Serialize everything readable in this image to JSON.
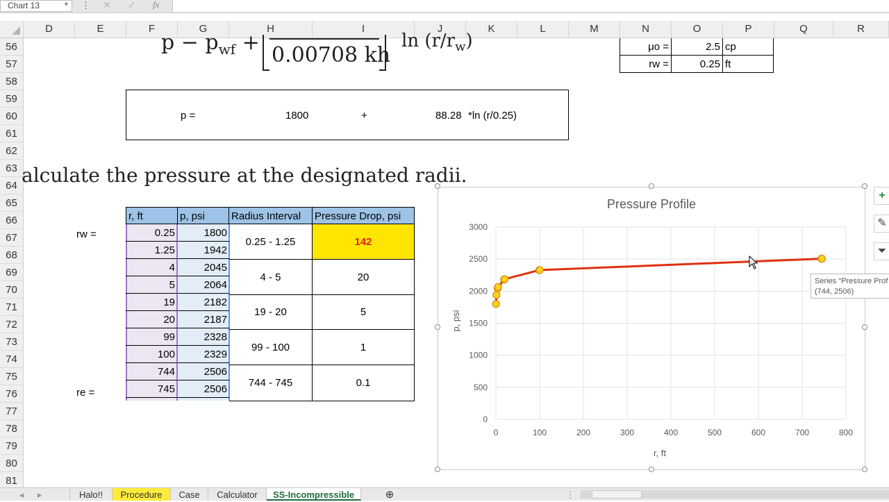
{
  "formula_bar": {
    "name_box": "Chart 13",
    "more_icon": "vertical-ellipsis-icon",
    "cancel_icon": "close-icon",
    "enter_icon": "check-icon",
    "function_label": "fx"
  },
  "columns": [
    "D",
    "E",
    "F",
    "G",
    "H",
    "I",
    "J",
    "K",
    "L",
    "M",
    "N",
    "O",
    "P",
    "Q",
    "R"
  ],
  "rows": [
    "56",
    "57",
    "58",
    "59",
    "60",
    "61",
    "62",
    "63",
    "64",
    "65",
    "66",
    "67",
    "68",
    "69",
    "70",
    "71",
    "72",
    "73",
    "74",
    "75",
    "76",
    "77",
    "78",
    "79",
    "80",
    "81"
  ],
  "equation": {
    "lhs": "p − p",
    "lhs_sub": "wf",
    "plus": " +",
    "denominator": "0.00708 kh",
    "ln_term": "ln (r/r",
    "ln_sub": "w",
    "ln_close": ")"
  },
  "params": [
    {
      "label": "μo =",
      "value": "2.5",
      "unit": "cp"
    },
    {
      "label": "rw =",
      "value": "0.25",
      "unit": "ft"
    }
  ],
  "formula_box": {
    "p_label": "p =",
    "pwf": "1800",
    "plus": "+",
    "coef": "88.28",
    "ln_text": "*ln (r/0.25)"
  },
  "calc_text": "alculate the pressure at the designated radii.",
  "side_labels": {
    "rw": "rw =",
    "re": "re ="
  },
  "table": {
    "headers": [
      "r, ft",
      "p, psi",
      "Radius Interval",
      "Pressure Drop, psi"
    ],
    "r": [
      "0.25",
      "1.25",
      "4",
      "5",
      "19",
      "20",
      "99",
      "100",
      "744",
      "745"
    ],
    "p": [
      "1800",
      "1942",
      "2045",
      "2064",
      "2182",
      "2187",
      "2328",
      "2329",
      "2506",
      "2506"
    ],
    "intervals": [
      "0.25 - 1.25",
      "4 - 5",
      "19 - 20",
      "99 - 100",
      "744 - 745"
    ],
    "drops": [
      "142",
      "20",
      "5",
      "1",
      "0.1"
    ],
    "highlight_color": "#ffe600",
    "highlight_text_color": "#e02020",
    "header_color": "#9dc3e6"
  },
  "chart_data": {
    "type": "scatter",
    "title": "Pressure Profile",
    "xlabel": "r, ft",
    "ylabel": "p, psi",
    "xlim": [
      0,
      800
    ],
    "ylim": [
      0,
      3000
    ],
    "x_ticks": [
      "0",
      "100",
      "200",
      "300",
      "400",
      "500",
      "600",
      "700",
      "800"
    ],
    "y_ticks": [
      "0",
      "500",
      "1000",
      "1500",
      "2000",
      "2500",
      "3000"
    ],
    "grid": true,
    "series": [
      {
        "line_color": "#e03010",
        "marker_color": "#ffd21f",
        "x": [
          0.25,
          1.25,
          4,
          5,
          19,
          20,
          99,
          100,
          744,
          745
        ],
        "y": [
          1800,
          1942,
          2045,
          2064,
          2182,
          2187,
          2328,
          2329,
          2506,
          2506
        ]
      }
    ]
  },
  "chart_buttons": [
    {
      "name": "chart-elements-button",
      "icon": "plus-icon"
    },
    {
      "name": "chart-styles-button",
      "icon": "brush-icon"
    },
    {
      "name": "chart-filters-button",
      "icon": "filter-icon"
    }
  ],
  "tooltip": {
    "line1": "Series \"Pressure Prof",
    "line2": "(744, 2506)"
  },
  "sheet_tabs": [
    {
      "label": "Halo!!",
      "active": false,
      "color": ""
    },
    {
      "label": "Procedure",
      "active": false,
      "color": "#ffeb3b"
    },
    {
      "label": "Case",
      "active": false,
      "color": ""
    },
    {
      "label": "Calculator",
      "active": false,
      "color": ""
    },
    {
      "label": "SS-Incompressible",
      "active": true,
      "color": ""
    }
  ],
  "add_sheet_icon": "plus-circle-icon"
}
